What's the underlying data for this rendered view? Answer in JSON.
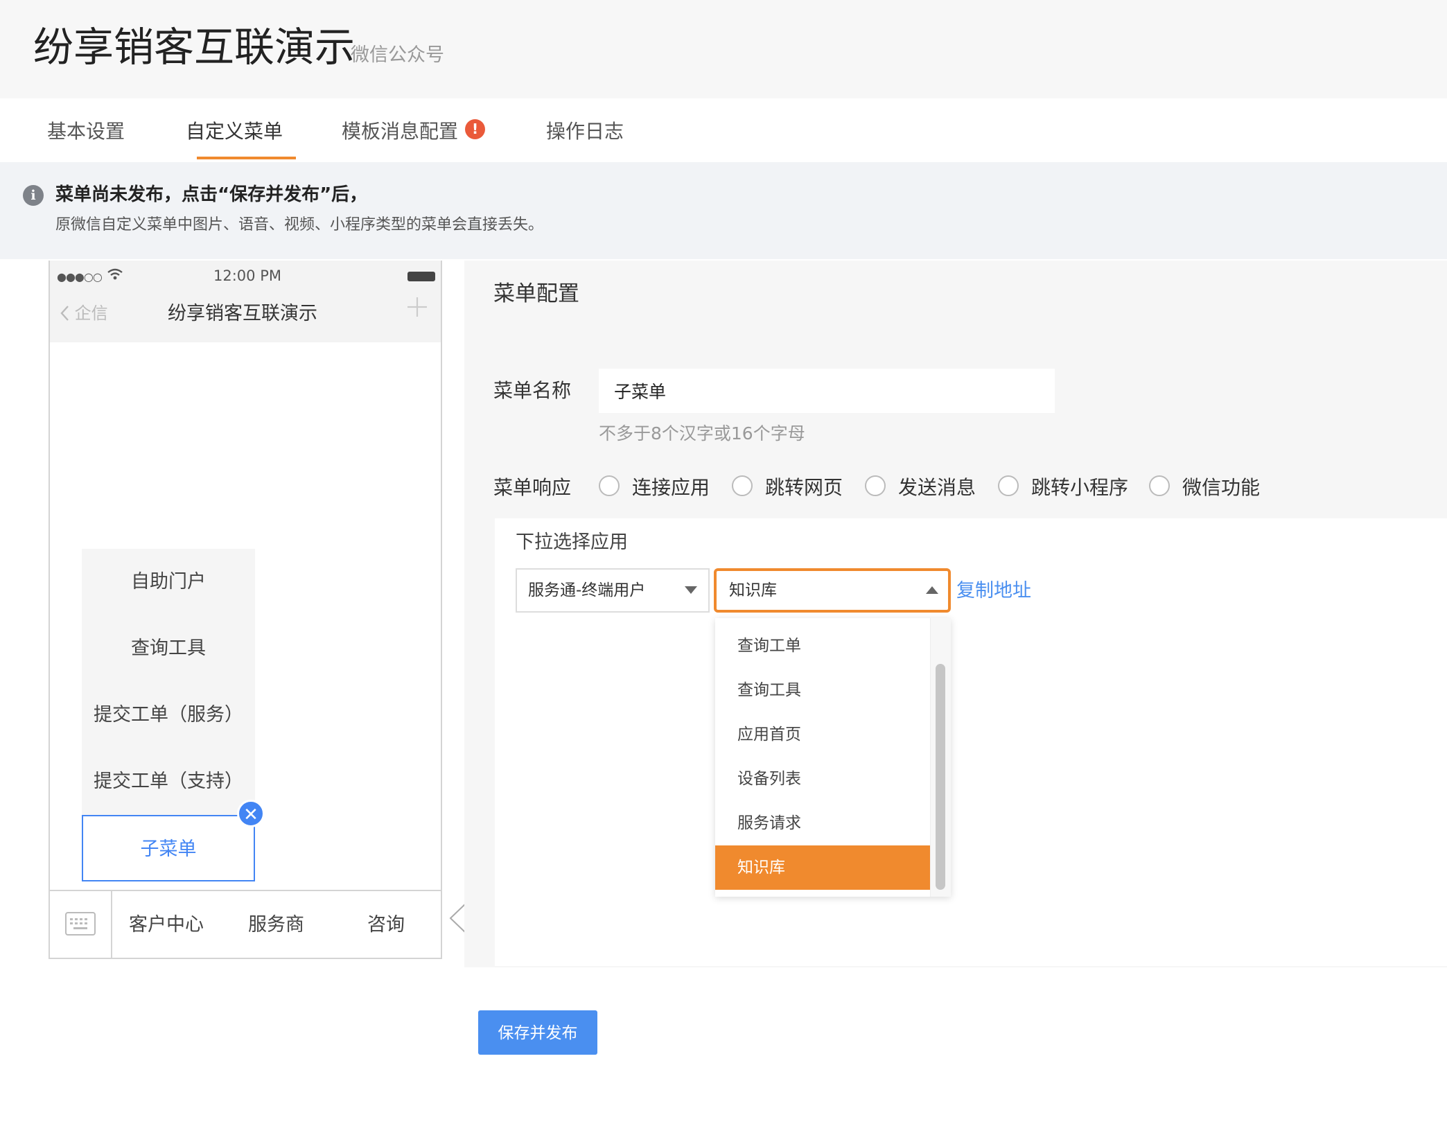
{
  "header": {
    "title": "纷享销客互联演示",
    "subtitle": "微信公众号"
  },
  "tabs": [
    {
      "label": "基本设置"
    },
    {
      "label": "自定义菜单",
      "active": true
    },
    {
      "label": "模板消息配置",
      "alert": "!"
    },
    {
      "label": "操作日志"
    }
  ],
  "notice": {
    "title": "菜单尚未发布，点击“保存并发布”后，",
    "description": "原微信自定义菜单中图片、语音、视频、小程序类型的菜单会直接丢失。"
  },
  "phone": {
    "status": {
      "time": "12:00 PM"
    },
    "nav": {
      "back": "企信",
      "title": "纷享销客互联演示"
    },
    "submenu": [
      "自助门户",
      "查询工具",
      "提交工单（服务）",
      "提交工单（支持）",
      "子菜单"
    ],
    "bottom_menu": [
      "客户中心",
      "服务商",
      "咨询"
    ]
  },
  "config": {
    "title": "菜单配置",
    "name_label": "菜单名称",
    "name_value": "子菜单",
    "name_hint": "不多于8个汉字或16个字母",
    "response_label": "菜单响应",
    "response_options": [
      "连接应用",
      "跳转网页",
      "发送消息",
      "跳转小程序",
      "微信功能"
    ],
    "select_app_label": "下拉选择应用",
    "select1_value": "服务通-终端用户",
    "select2_value": "知识库",
    "copy_link": "复制地址",
    "dropdown_options": [
      "查询工单",
      "查询工具",
      "应用首页",
      "设备列表",
      "服务请求",
      "知识库"
    ],
    "dropdown_selected": "知识库"
  },
  "actions": {
    "publish": "保存并发布"
  },
  "colors": {
    "accent": "#f08a2e",
    "primary": "#4a8ff0",
    "alert": "#ea5a3a"
  }
}
